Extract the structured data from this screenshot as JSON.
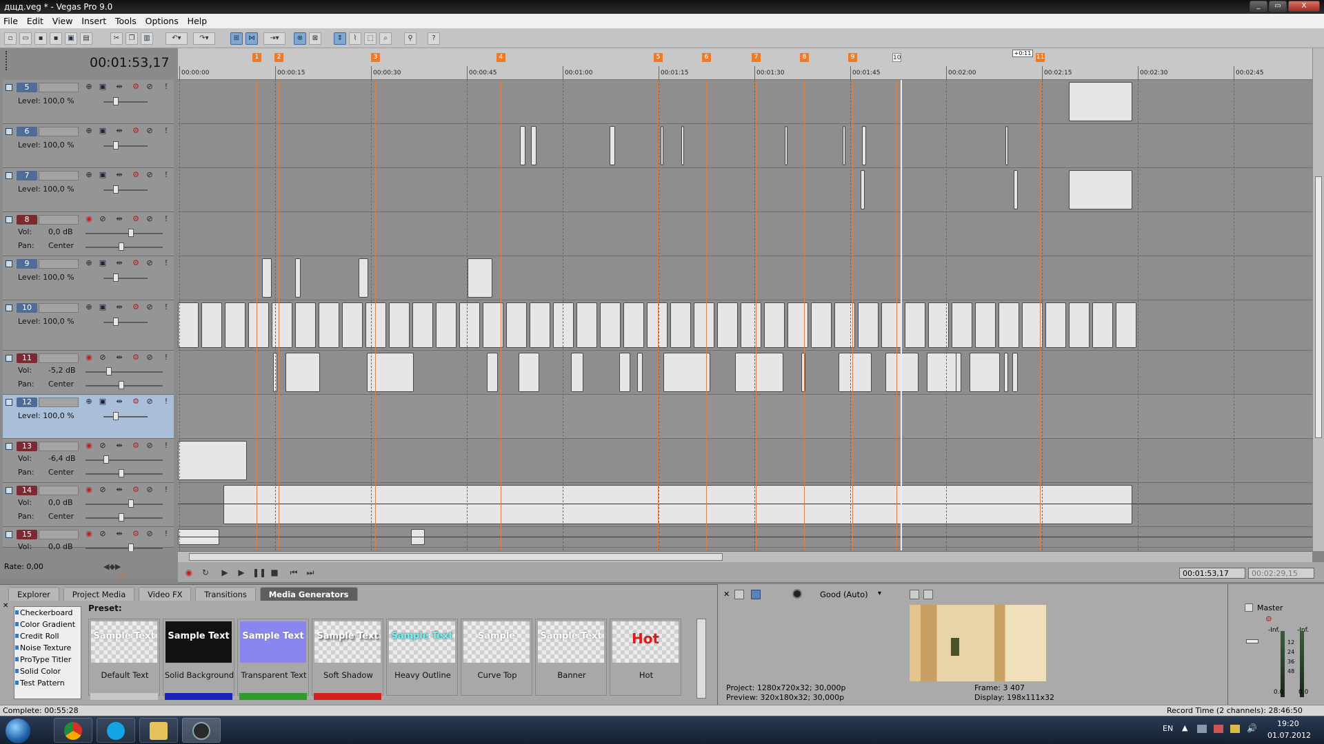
{
  "window": {
    "title": "дщд.veg * - Vegas Pro 9.0",
    "min": "_",
    "max": "▭",
    "close": "X"
  },
  "menu": [
    "File",
    "Edit",
    "View",
    "Insert",
    "Tools",
    "Options",
    "Help"
  ],
  "timeline": {
    "timecode": "00:01:53,17",
    "markers": [
      "1",
      "2",
      "3",
      "4",
      "5",
      "6",
      "7",
      "8",
      "9",
      "10",
      "11"
    ],
    "selection_len": "+0:11",
    "ruler_labels": [
      "00:00:00",
      "00:00:15",
      "00:00:30",
      "00:00:45",
      "00:01:00",
      "00:01:15",
      "00:01:30",
      "00:01:45",
      "00:02:00",
      "00:02:15",
      "00:02:30",
      "00:02:45"
    ]
  },
  "tracks": [
    {
      "num": "5",
      "kind": "video",
      "label1": "Level: 100,0 %"
    },
    {
      "num": "6",
      "kind": "video",
      "label1": "Level: 100,0 %"
    },
    {
      "num": "7",
      "kind": "video",
      "label1": "Level: 100,0 %"
    },
    {
      "num": "8",
      "kind": "audio",
      "label1": "Vol:",
      "val1": "0,0 dB",
      "label2": "Pan:",
      "val2": "Center"
    },
    {
      "num": "9",
      "kind": "video",
      "label1": "Level: 100,0 %"
    },
    {
      "num": "10",
      "kind": "video",
      "label1": "Level: 100,0 %"
    },
    {
      "num": "11",
      "kind": "audio",
      "label1": "Vol:",
      "val1": "-5,2 dB",
      "label2": "Pan:",
      "val2": "Center"
    },
    {
      "num": "12",
      "kind": "video",
      "label1": "Level: 100,0 %"
    },
    {
      "num": "13",
      "kind": "audio",
      "label1": "Vol:",
      "val1": "-6,4 dB",
      "label2": "Pan:",
      "val2": "Center"
    },
    {
      "num": "14",
      "kind": "audio",
      "label1": "Vol:",
      "val1": "0,0 dB",
      "label2": "Pan:",
      "val2": "Center"
    },
    {
      "num": "15",
      "kind": "audio",
      "label1": "Vol:",
      "val1": "0,0 dB"
    }
  ],
  "rate": "Rate: 0,00",
  "transport": {
    "cursor_time": "00:01:53,17",
    "end_time": "00:02:29,15"
  },
  "bottom_tabs": [
    "Explorer",
    "Project Media",
    "Video FX",
    "Transitions",
    "Media Generators"
  ],
  "generators": [
    "Checkerboard",
    "Color Gradient",
    "Credit Roll",
    "Noise Texture",
    "ProType Titler",
    "Solid Color",
    "Test Pattern"
  ],
  "preset_label": "Preset:",
  "presets": [
    {
      "name": "Default Text",
      "sample": "Sample Text"
    },
    {
      "name": "Solid Background",
      "sample": "Sample Text"
    },
    {
      "name": "Transparent Text",
      "sample": "Sample Text"
    },
    {
      "name": "Soft Shadow",
      "sample": "Sample Text"
    },
    {
      "name": "Heavy Outline",
      "sample": "Sample Text"
    },
    {
      "name": "Curve Top",
      "sample": "Sample"
    },
    {
      "name": "Banner",
      "sample": "Sample Text"
    },
    {
      "name": "Hot",
      "sample": "Hot"
    }
  ],
  "preset_colors": [
    "#c8c8c8",
    "#1a23b8",
    "#2d9b2d",
    "#d81f1f"
  ],
  "preview": {
    "quality": "Good (Auto)",
    "project": "Project:   1280x720x32; 30,000p",
    "preview": "Preview:   320x180x32; 30,000p",
    "frame": "Frame:      3 407",
    "display": "Display:   198x111x32"
  },
  "mixer": {
    "label": "Master",
    "inf_left": "-Inf.",
    "inf_right": "-Inf.",
    "scale": [
      "12",
      "24",
      "36",
      "48"
    ],
    "bottom_left": "0.0",
    "bottom_right": "0.0"
  },
  "status": {
    "left": "Complete: 00:55:28",
    "right": "Record Time (2 channels): 28:46:50"
  },
  "taskbar": {
    "lang": "EN",
    "time": "19:20",
    "date": "01.07.2012"
  },
  "colors": {
    "marker": "#f07b26",
    "video_track": "#4f6c96",
    "audio_track": "#7c2a31",
    "envelope": "#1a2aa8",
    "fade_marker": "#2fc7b8"
  }
}
